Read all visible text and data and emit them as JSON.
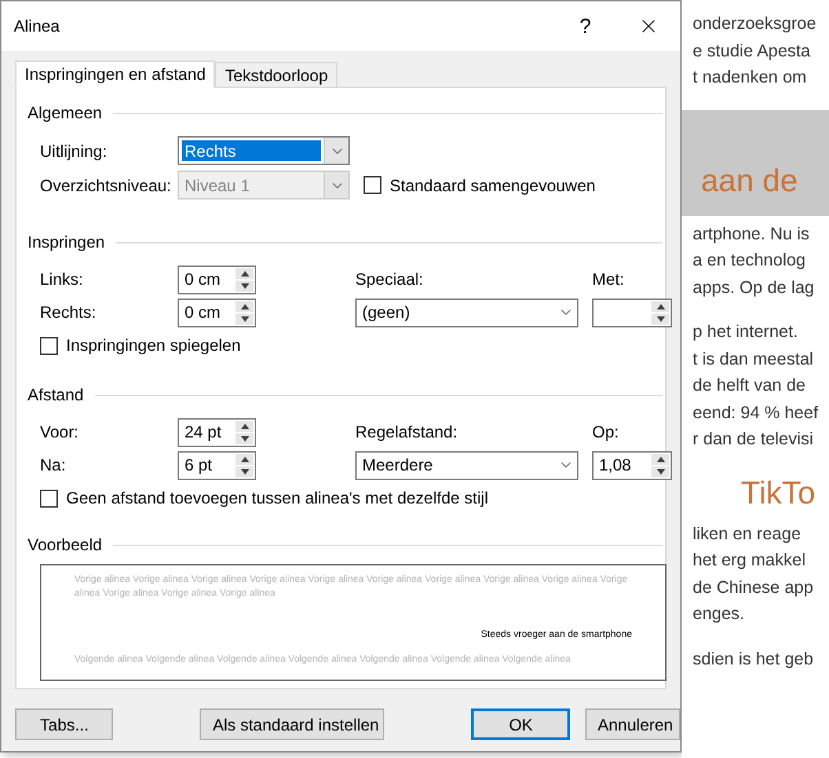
{
  "dialog": {
    "title": "Alinea",
    "help_button": "?",
    "tabs": [
      {
        "label": "Inspringingen en afstand",
        "selected": true
      },
      {
        "label": "Tekstdoorloop",
        "selected": false
      }
    ],
    "general": {
      "heading": "Algemeen",
      "alignment": {
        "label": "Uitlijning:",
        "value": "Rechts",
        "focused": true,
        "disabled": false
      },
      "outline_level": {
        "label": "Overzichtsniveau:",
        "value": "Niveau 1",
        "focused": false,
        "disabled": true
      },
      "collapsed_checkbox": {
        "label": "Standaard samengevouwen",
        "checked": false
      }
    },
    "indentation": {
      "heading": "Inspringen",
      "left": {
        "label": "Links:",
        "value": "0 cm"
      },
      "right": {
        "label": "Rechts:",
        "value": "0 cm"
      },
      "special": {
        "label": "Speciaal:",
        "value": "(geen)",
        "focused": false,
        "disabled": false
      },
      "by": {
        "label": "Met:"
      },
      "mirror_checkbox": {
        "label": "Inspringingen spiegelen",
        "checked": false
      }
    },
    "spacing": {
      "heading": "Afstand",
      "before": {
        "label": "Voor:",
        "value": "24 pt"
      },
      "after": {
        "label": "Na:",
        "value": "6 pt"
      },
      "line_spacing": {
        "label": "Regelafstand:",
        "value": "Meerdere",
        "focused": false,
        "disabled": false
      },
      "at": {
        "label": "Op:",
        "value": "1,08"
      },
      "no_space_checkbox": {
        "label": "Geen afstand toevoegen tussen alinea's met dezelfde stijl",
        "checked": false
      }
    },
    "preview": {
      "heading": "Voorbeeld",
      "previous_text": "Vorige alinea Vorige alinea Vorige alinea Vorige alinea Vorige alinea Vorige alinea Vorige alinea Vorige alinea Vorige alinea Vorige alinea Vorige alinea Vorige alinea Vorige alinea",
      "current_text": "Steeds vroeger aan de smartphone",
      "next_text": "Volgende alinea Volgende alinea Volgende alinea Volgende alinea Volgende alinea Volgende alinea Volgende alinea"
    },
    "buttons": [
      {
        "label": "Tabs...",
        "default": false
      },
      {
        "label": "Als standaard instellen",
        "default": false
      },
      {
        "label": "OK",
        "default": true
      },
      {
        "label": "Annuleren",
        "default": false
      }
    ]
  },
  "document": {
    "blocks": [
      {
        "kind": "paragraph",
        "lines": [
          "onderzoeksgroe",
          "e studie Apesta",
          "t nadenken om"
        ]
      },
      {
        "kind": "shaded_heading",
        "text": "aan de"
      },
      {
        "kind": "paragraph",
        "lines": [
          "artphone. Nu is",
          "a en technolog",
          "apps. Op de lag"
        ]
      },
      {
        "kind": "paragraph",
        "lines": [
          "p het internet.",
          "t is dan meestal",
          "de helft van de",
          "eend: 94 % heef",
          "r dan de televisi"
        ]
      },
      {
        "kind": "heading",
        "text": "TikTo"
      },
      {
        "kind": "paragraph",
        "lines": [
          "liken en reage",
          "het erg makkel",
          "de Chinese app",
          "enges."
        ]
      },
      {
        "kind": "paragraph",
        "lines": [
          "sdien is het geb"
        ]
      }
    ]
  }
}
